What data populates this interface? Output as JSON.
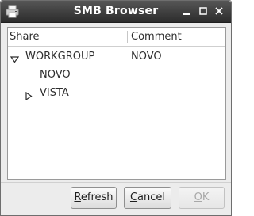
{
  "window": {
    "title": "SMB Browser",
    "controls": {
      "minimize": "minimize",
      "maximize": "maximize",
      "close": "close"
    }
  },
  "list": {
    "columns": {
      "share": "Share",
      "comment": "Comment"
    },
    "rows": [
      {
        "name": "WORKGROUP",
        "comment": "NOVO",
        "expander": "expanded"
      },
      {
        "name": "NOVO",
        "comment": "",
        "expander": "none"
      },
      {
        "name": "VISTA",
        "comment": "",
        "expander": "collapsed"
      }
    ]
  },
  "buttons": {
    "refresh": {
      "first": "R",
      "rest": "efresh",
      "enabled": true
    },
    "cancel": {
      "first": "C",
      "rest": "ancel",
      "enabled": true
    },
    "ok": {
      "first": "O",
      "rest": "K",
      "enabled": false
    }
  },
  "colors": {
    "titlebar_top": "#565656",
    "titlebar_bottom": "#2c2c2c",
    "window_bg": "#ececec",
    "disabled_text": "#a8a8a8"
  }
}
